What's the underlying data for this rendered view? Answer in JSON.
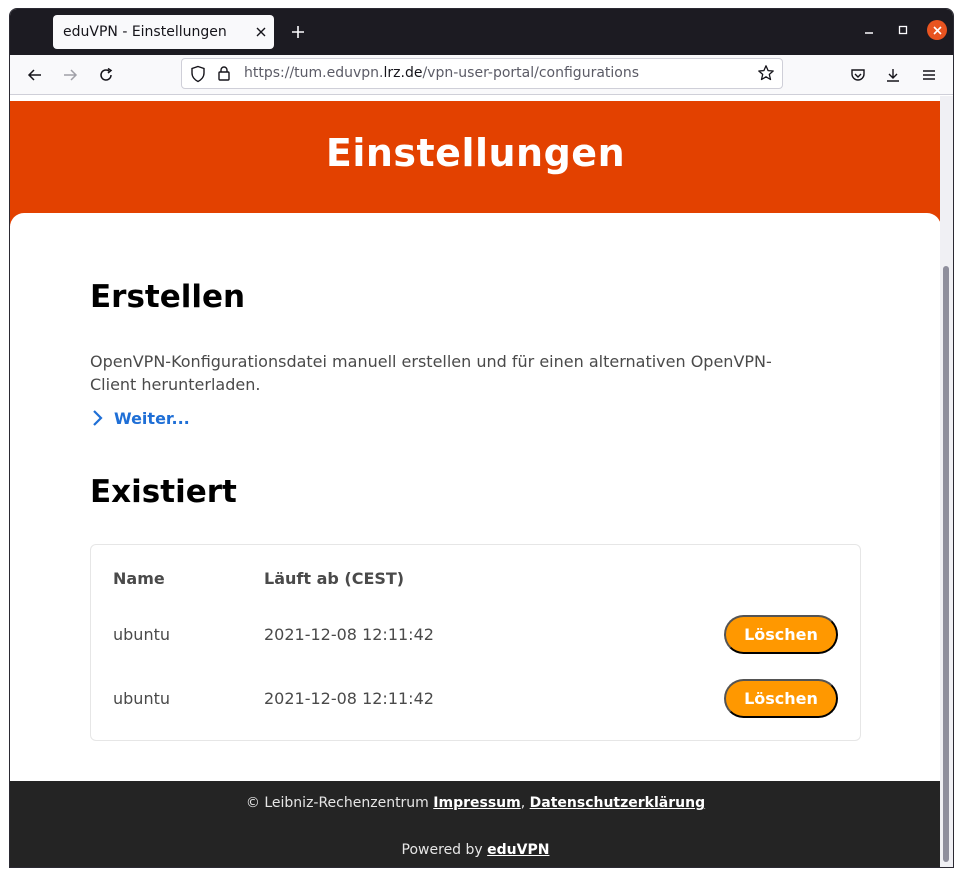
{
  "browser": {
    "tab_title": "eduVPN - Einstellungen",
    "url_prefix": "https://tum.eduvpn.",
    "url_domain": "lrz.de",
    "url_path": "/vpn-user-portal/configurations"
  },
  "page": {
    "hero_title": "Einstellungen",
    "create": {
      "heading": "Erstellen",
      "description": "OpenVPN-Konfigurationsdatei manuell erstellen und für einen alternativen OpenVPN-Client herunterladen.",
      "more_label": "Weiter..."
    },
    "existing": {
      "heading": "Existiert",
      "columns": [
        "Name",
        "Läuft ab (CEST)"
      ],
      "rows": [
        {
          "name": "ubuntu",
          "expires": "2021-12-08 12:11:42",
          "action": "Löschen"
        },
        {
          "name": "ubuntu",
          "expires": "2021-12-08 12:11:42",
          "action": "Löschen"
        }
      ]
    }
  },
  "footer": {
    "copyright": "© Leibniz-Rechenzentrum",
    "impressum": "Impressum",
    "separator": ",",
    "privacy": "Datenschutzerklärung",
    "powered_prefix": "Powered by",
    "powered_link": "eduVPN"
  },
  "colors": {
    "hero": "#e34100",
    "delete_button": "#ff9800",
    "link": "#1f6fd6",
    "footer": "#242424",
    "window_close": "#e95420"
  },
  "icons": {
    "new_tab": "plus-icon",
    "back": "arrow-left-icon",
    "forward": "arrow-right-icon",
    "reload": "reload-icon",
    "shield": "shield-icon",
    "lock": "lock-icon",
    "bookmark": "star-icon",
    "pocket": "pocket-icon",
    "downloads": "download-icon",
    "menu": "hamburger-menu-icon",
    "more_link": "chevron-right-icon"
  }
}
